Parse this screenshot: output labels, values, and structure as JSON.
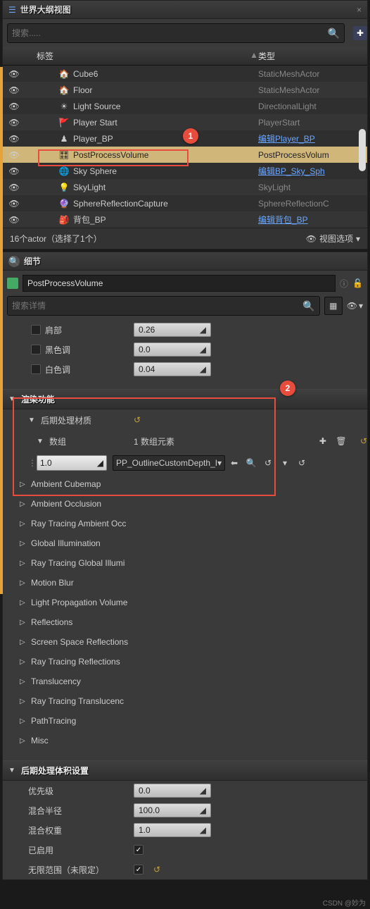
{
  "outliner": {
    "title": "世界大纲视图",
    "search_placeholder": "搜索.....",
    "col_label": "标签",
    "col_type": "类型",
    "rows": [
      {
        "label": "Cube6",
        "type": "StaticMeshActor",
        "icon": "cube"
      },
      {
        "label": "Floor",
        "type": "StaticMeshActor",
        "icon": "cube"
      },
      {
        "label": "Light Source",
        "type": "DirectionalLight",
        "icon": "sun"
      },
      {
        "label": "Player Start",
        "type": "PlayerStart",
        "icon": "flag"
      },
      {
        "label": "Player_BP",
        "type": "编辑Player_BP",
        "icon": "pawn",
        "link": true
      },
      {
        "label": "PostProcessVolume",
        "type": "PostProcessVolum",
        "icon": "ppv",
        "selected": true
      },
      {
        "label": "Sky Sphere",
        "type": "编辑BP_Sky_Sph",
        "icon": "sphere",
        "link": true
      },
      {
        "label": "SkyLight",
        "type": "SkyLight",
        "icon": "skylight"
      },
      {
        "label": "SphereReflectionCapture",
        "type": "SphereReflectionC",
        "icon": "reflection"
      },
      {
        "label": "背包_BP",
        "type": "编辑背包_BP",
        "icon": "bag",
        "link": true
      }
    ],
    "footer_count": "16个actor（选择了1个）",
    "view_options": "视图选项"
  },
  "details": {
    "title": "细节",
    "actor_name": "PostProcessVolume",
    "search_placeholder": "搜索详情",
    "tint_props": {
      "shoulder": {
        "label": "肩部",
        "value": "0.26"
      },
      "black": {
        "label": "黑色调",
        "value": "0.0"
      },
      "white": {
        "label": "白色调",
        "value": "0.04"
      }
    },
    "rendering": {
      "header": "渲染功能",
      "post_materials": "后期处理材质",
      "array_label": "数组",
      "array_count": "1 数组元素",
      "elem_weight": "1.0",
      "elem_asset": "PP_OutlineCustomDepth_I",
      "categories": [
        "Ambient Cubemap",
        "Ambient Occlusion",
        "Ray Tracing Ambient Occ",
        "Global Illumination",
        "Ray Tracing Global Illumi",
        "Motion Blur",
        "Light Propagation Volume",
        "Reflections",
        "Screen Space Reflections",
        "Ray Tracing Reflections",
        "Translucency",
        "Ray Tracing Translucenc",
        "PathTracing",
        "Misc"
      ]
    },
    "volume_settings": {
      "header": "后期处理体积设置",
      "priority": {
        "label": "优先级",
        "value": "0.0"
      },
      "blend_radius": {
        "label": "混合半径",
        "value": "100.0"
      },
      "blend_weight": {
        "label": "混合权重",
        "value": "1.0"
      },
      "enabled": {
        "label": "已启用"
      },
      "unbound": {
        "label": "无限范围（未限定）"
      }
    }
  },
  "callouts": {
    "c1": "1",
    "c2": "2"
  },
  "watermark": "CSDN @妙为"
}
